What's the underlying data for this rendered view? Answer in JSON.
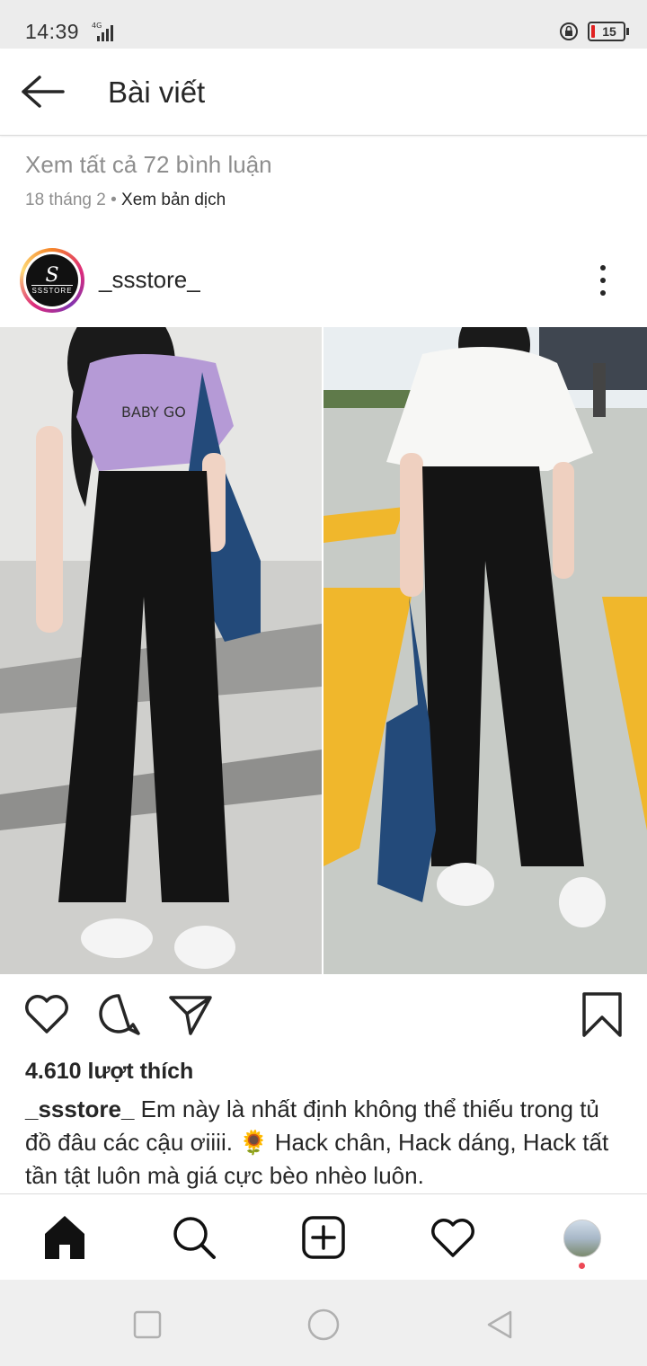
{
  "status_bar": {
    "time": "14:39",
    "network": "4G",
    "battery": "15"
  },
  "header": {
    "title": "Bài viết",
    "back_icon": "arrow-left-icon"
  },
  "prev_post": {
    "view_comments": "Xem tất cả 72 bình luận",
    "date": "18 tháng 2",
    "separator": "•",
    "translate": "Xem bản dịch"
  },
  "post": {
    "username": "_ssstore_",
    "avatar_text": "SSSTORE",
    "likes": "4.610 lượt thích",
    "caption_user": "_ssstore_",
    "caption_text": " Em này là nhất định không thể thiếu trong tủ đồ đâu các cậu ơiiii. 🌻 Hack chân, Hack dáng, Hack tất tần tật luôn mà giá cực bèo nhèo luôn."
  },
  "colors": {
    "notification_dot": "#ed4956",
    "text": "#262626",
    "muted": "#8e8e8e",
    "top_color": "#b59ad6",
    "pants": "#141414",
    "bag": "#234a7a"
  }
}
